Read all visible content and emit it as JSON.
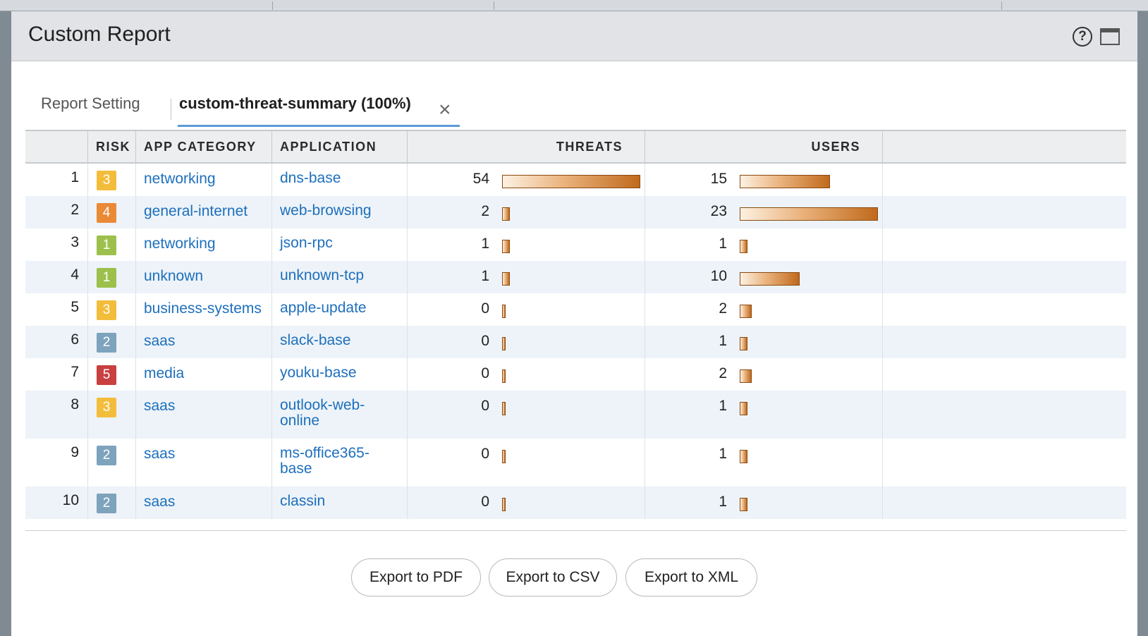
{
  "dialog": {
    "title": "Custom Report",
    "help_icon": "question-circle-icon",
    "maximize_icon": "maximize-window-icon"
  },
  "tabs": {
    "setting_label": "Report Setting",
    "active_label": "custom-threat-summary (100%)",
    "close_icon": "close-icon"
  },
  "table": {
    "headers": [
      "RISK",
      "APP CATEGORY",
      "APPLICATION",
      "THREATS",
      "USERS"
    ],
    "max_threats": 54,
    "max_users": 23,
    "rows": [
      {
        "index": "1",
        "risk": "3",
        "risk_color": "#f3bd3c",
        "category": "networking",
        "application": "dns-base",
        "threats": 54,
        "users": 15
      },
      {
        "index": "2",
        "risk": "4",
        "risk_color": "#ea8a36",
        "category": "general-internet",
        "application": "web-browsing",
        "threats": 2,
        "users": 23
      },
      {
        "index": "3",
        "risk": "1",
        "risk_color": "#9cc04b",
        "category": "networking",
        "application": "json-rpc",
        "threats": 1,
        "users": 1
      },
      {
        "index": "4",
        "risk": "1",
        "risk_color": "#9cc04b",
        "category": "unknown",
        "application": "unknown-tcp",
        "threats": 1,
        "users": 10
      },
      {
        "index": "5",
        "risk": "3",
        "risk_color": "#f3bd3c",
        "category": "business-systems",
        "application": "apple-update",
        "threats": 0,
        "users": 2
      },
      {
        "index": "6",
        "risk": "2",
        "risk_color": "#7da3bd",
        "category": "saas",
        "application": "slack-base",
        "threats": 0,
        "users": 1
      },
      {
        "index": "7",
        "risk": "5",
        "risk_color": "#c8403f",
        "category": "media",
        "application": "youku-base",
        "threats": 0,
        "users": 2
      },
      {
        "index": "8",
        "risk": "3",
        "risk_color": "#f3bd3c",
        "category": "saas",
        "application": "outlook-web-online",
        "application_lines": [
          "outlook-web-",
          "online"
        ],
        "threats": 0,
        "users": 1
      },
      {
        "index": "9",
        "risk": "2",
        "risk_color": "#7da3bd",
        "category": "saas",
        "application": "ms-office365-base",
        "application_lines": [
          "ms-office365-",
          "base"
        ],
        "threats": 0,
        "users": 1
      },
      {
        "index": "10",
        "risk": "2",
        "risk_color": "#7da3bd",
        "category": "saas",
        "application": "classin",
        "threats": 0,
        "users": 1
      }
    ]
  },
  "buttons": {
    "export_pdf": "Export to PDF",
    "export_csv": "Export to CSV",
    "export_xml": "Export to XML"
  }
}
